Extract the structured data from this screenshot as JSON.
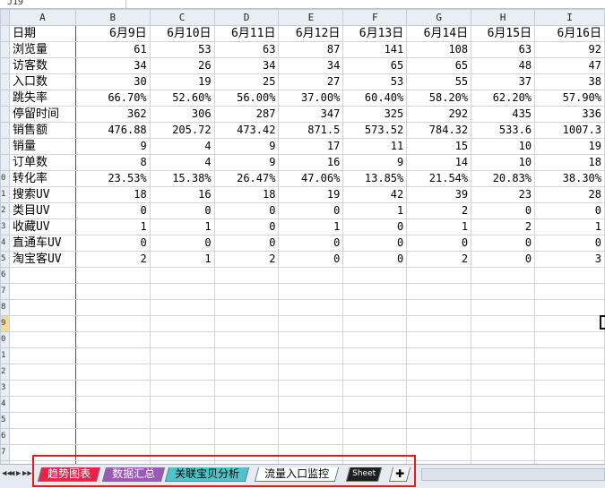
{
  "name_box": "J19",
  "columns": [
    "A",
    "B",
    "C",
    "D",
    "E",
    "F",
    "G",
    "H",
    "I"
  ],
  "rows": [
    {
      "n": "",
      "cells": [
        "日期",
        "6月9日",
        "6月10日",
        "6月11日",
        "6月12日",
        "6月13日",
        "6月14日",
        "6月15日",
        "6月16日"
      ]
    },
    {
      "n": "",
      "cells": [
        "浏览量",
        "61",
        "53",
        "63",
        "87",
        "141",
        "108",
        "63",
        "92"
      ]
    },
    {
      "n": "",
      "cells": [
        "访客数",
        "34",
        "26",
        "34",
        "34",
        "65",
        "65",
        "48",
        "47"
      ]
    },
    {
      "n": "",
      "cells": [
        "入口数",
        "30",
        "19",
        "25",
        "27",
        "53",
        "55",
        "37",
        "38"
      ]
    },
    {
      "n": "",
      "cells": [
        "跳失率",
        "66.70%",
        "52.60%",
        "56.00%",
        "37.00%",
        "60.40%",
        "58.20%",
        "62.20%",
        "57.90%"
      ]
    },
    {
      "n": "",
      "cells": [
        "停留时间",
        "362",
        "306",
        "287",
        "347",
        "325",
        "292",
        "435",
        "336"
      ]
    },
    {
      "n": "",
      "cells": [
        "销售额",
        "476.88",
        "205.72",
        "473.42",
        "871.5",
        "573.52",
        "784.32",
        "533.6",
        "1007.3"
      ]
    },
    {
      "n": "",
      "cells": [
        "销量",
        "9",
        "4",
        "9",
        "17",
        "11",
        "15",
        "10",
        "19"
      ]
    },
    {
      "n": "",
      "cells": [
        "订单数",
        "8",
        "4",
        "9",
        "16",
        "9",
        "14",
        "10",
        "18"
      ]
    },
    {
      "n": "0",
      "cells": [
        "转化率",
        "23.53%",
        "15.38%",
        "26.47%",
        "47.06%",
        "13.85%",
        "21.54%",
        "20.83%",
        "38.30%"
      ]
    },
    {
      "n": "1",
      "cells": [
        "搜索UV",
        "18",
        "16",
        "18",
        "19",
        "42",
        "39",
        "23",
        "28"
      ]
    },
    {
      "n": "2",
      "cells": [
        "类目UV",
        "0",
        "0",
        "0",
        "0",
        "1",
        "2",
        "0",
        "0"
      ]
    },
    {
      "n": "3",
      "cells": [
        "收藏UV",
        "1",
        "1",
        "0",
        "1",
        "0",
        "1",
        "2",
        "1"
      ]
    },
    {
      "n": "4",
      "cells": [
        "直通车UV",
        "0",
        "0",
        "0",
        "0",
        "0",
        "0",
        "0",
        "0"
      ]
    },
    {
      "n": "5",
      "cells": [
        "淘宝客UV",
        "2",
        "1",
        "2",
        "0",
        "0",
        "2",
        "0",
        "3"
      ]
    },
    {
      "n": "6",
      "cells": [
        "",
        "",
        "",
        "",
        "",
        "",
        "",
        "",
        ""
      ]
    },
    {
      "n": "7",
      "cells": [
        "",
        "",
        "",
        "",
        "",
        "",
        "",
        "",
        ""
      ]
    },
    {
      "n": "8",
      "cells": [
        "",
        "",
        "",
        "",
        "",
        "",
        "",
        "",
        ""
      ]
    },
    {
      "n": "9",
      "cells": [
        "",
        "",
        "",
        "",
        "",
        "",
        "",
        "",
        ""
      ]
    },
    {
      "n": "0",
      "cells": [
        "",
        "",
        "",
        "",
        "",
        "",
        "",
        "",
        ""
      ]
    },
    {
      "n": "1",
      "cells": [
        "",
        "",
        "",
        "",
        "",
        "",
        "",
        "",
        ""
      ]
    },
    {
      "n": "2",
      "cells": [
        "",
        "",
        "",
        "",
        "",
        "",
        "",
        "",
        ""
      ]
    },
    {
      "n": "3",
      "cells": [
        "",
        "",
        "",
        "",
        "",
        "",
        "",
        "",
        ""
      ]
    },
    {
      "n": "4",
      "cells": [
        "",
        "",
        "",
        "",
        "",
        "",
        "",
        "",
        ""
      ]
    },
    {
      "n": "5",
      "cells": [
        "",
        "",
        "",
        "",
        "",
        "",
        "",
        "",
        ""
      ]
    },
    {
      "n": "6",
      "cells": [
        "",
        "",
        "",
        "",
        "",
        "",
        "",
        "",
        ""
      ]
    },
    {
      "n": "7",
      "cells": [
        "",
        "",
        "",
        "",
        "",
        "",
        "",
        "",
        ""
      ]
    },
    {
      "n": "8",
      "cells": [
        "",
        "",
        "",
        "",
        "",
        "",
        "",
        "",
        ""
      ]
    }
  ],
  "sheet_tabs": [
    {
      "label": "趋势图表",
      "bg": "#e8234a",
      "fg": "#ffffff"
    },
    {
      "label": "数据汇总",
      "bg": "#9b59b6",
      "fg": "#ffffff"
    },
    {
      "label": "关联宝贝分析",
      "bg": "#4fc3c8",
      "fg": "#000000"
    },
    {
      "label": "流量入口监控",
      "bg": "#ffffff",
      "fg": "#000000"
    },
    {
      "label": "Sheet",
      "bg": "#1f1f1f",
      "fg": "#ffffff"
    }
  ],
  "nav_arrows": [
    "◀◀",
    "◀",
    "▶",
    "▶▶"
  ],
  "new_sheet_icon": "new-sheet-icon",
  "highlight_color": "#e41b1b"
}
